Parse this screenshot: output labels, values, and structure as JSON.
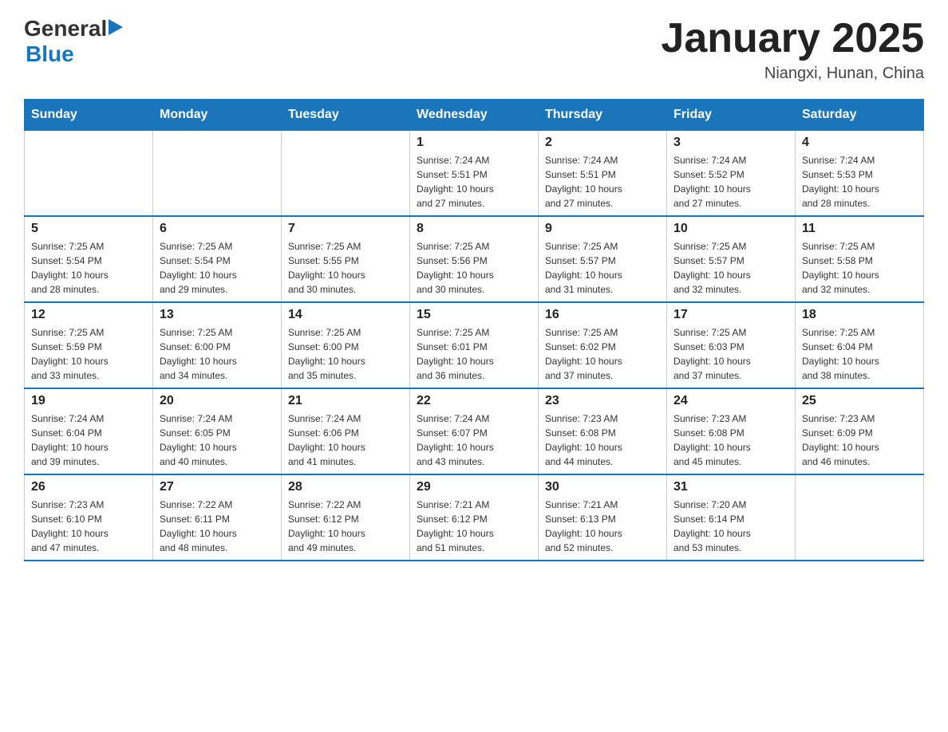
{
  "header": {
    "logo": {
      "general": "General",
      "blue": "Blue",
      "arrow": "▶"
    },
    "title": "January 2025",
    "location": "Niangxi, Hunan, China"
  },
  "calendar": {
    "days_of_week": [
      "Sunday",
      "Monday",
      "Tuesday",
      "Wednesday",
      "Thursday",
      "Friday",
      "Saturday"
    ],
    "weeks": [
      {
        "cells": [
          {
            "day": "",
            "info": ""
          },
          {
            "day": "",
            "info": ""
          },
          {
            "day": "",
            "info": ""
          },
          {
            "day": "1",
            "info": "Sunrise: 7:24 AM\nSunset: 5:51 PM\nDaylight: 10 hours\nand 27 minutes."
          },
          {
            "day": "2",
            "info": "Sunrise: 7:24 AM\nSunset: 5:51 PM\nDaylight: 10 hours\nand 27 minutes."
          },
          {
            "day": "3",
            "info": "Sunrise: 7:24 AM\nSunset: 5:52 PM\nDaylight: 10 hours\nand 27 minutes."
          },
          {
            "day": "4",
            "info": "Sunrise: 7:24 AM\nSunset: 5:53 PM\nDaylight: 10 hours\nand 28 minutes."
          }
        ]
      },
      {
        "cells": [
          {
            "day": "5",
            "info": "Sunrise: 7:25 AM\nSunset: 5:54 PM\nDaylight: 10 hours\nand 28 minutes."
          },
          {
            "day": "6",
            "info": "Sunrise: 7:25 AM\nSunset: 5:54 PM\nDaylight: 10 hours\nand 29 minutes."
          },
          {
            "day": "7",
            "info": "Sunrise: 7:25 AM\nSunset: 5:55 PM\nDaylight: 10 hours\nand 30 minutes."
          },
          {
            "day": "8",
            "info": "Sunrise: 7:25 AM\nSunset: 5:56 PM\nDaylight: 10 hours\nand 30 minutes."
          },
          {
            "day": "9",
            "info": "Sunrise: 7:25 AM\nSunset: 5:57 PM\nDaylight: 10 hours\nand 31 minutes."
          },
          {
            "day": "10",
            "info": "Sunrise: 7:25 AM\nSunset: 5:57 PM\nDaylight: 10 hours\nand 32 minutes."
          },
          {
            "day": "11",
            "info": "Sunrise: 7:25 AM\nSunset: 5:58 PM\nDaylight: 10 hours\nand 32 minutes."
          }
        ]
      },
      {
        "cells": [
          {
            "day": "12",
            "info": "Sunrise: 7:25 AM\nSunset: 5:59 PM\nDaylight: 10 hours\nand 33 minutes."
          },
          {
            "day": "13",
            "info": "Sunrise: 7:25 AM\nSunset: 6:00 PM\nDaylight: 10 hours\nand 34 minutes."
          },
          {
            "day": "14",
            "info": "Sunrise: 7:25 AM\nSunset: 6:00 PM\nDaylight: 10 hours\nand 35 minutes."
          },
          {
            "day": "15",
            "info": "Sunrise: 7:25 AM\nSunset: 6:01 PM\nDaylight: 10 hours\nand 36 minutes."
          },
          {
            "day": "16",
            "info": "Sunrise: 7:25 AM\nSunset: 6:02 PM\nDaylight: 10 hours\nand 37 minutes."
          },
          {
            "day": "17",
            "info": "Sunrise: 7:25 AM\nSunset: 6:03 PM\nDaylight: 10 hours\nand 37 minutes."
          },
          {
            "day": "18",
            "info": "Sunrise: 7:25 AM\nSunset: 6:04 PM\nDaylight: 10 hours\nand 38 minutes."
          }
        ]
      },
      {
        "cells": [
          {
            "day": "19",
            "info": "Sunrise: 7:24 AM\nSunset: 6:04 PM\nDaylight: 10 hours\nand 39 minutes."
          },
          {
            "day": "20",
            "info": "Sunrise: 7:24 AM\nSunset: 6:05 PM\nDaylight: 10 hours\nand 40 minutes."
          },
          {
            "day": "21",
            "info": "Sunrise: 7:24 AM\nSunset: 6:06 PM\nDaylight: 10 hours\nand 41 minutes."
          },
          {
            "day": "22",
            "info": "Sunrise: 7:24 AM\nSunset: 6:07 PM\nDaylight: 10 hours\nand 43 minutes."
          },
          {
            "day": "23",
            "info": "Sunrise: 7:23 AM\nSunset: 6:08 PM\nDaylight: 10 hours\nand 44 minutes."
          },
          {
            "day": "24",
            "info": "Sunrise: 7:23 AM\nSunset: 6:08 PM\nDaylight: 10 hours\nand 45 minutes."
          },
          {
            "day": "25",
            "info": "Sunrise: 7:23 AM\nSunset: 6:09 PM\nDaylight: 10 hours\nand 46 minutes."
          }
        ]
      },
      {
        "cells": [
          {
            "day": "26",
            "info": "Sunrise: 7:23 AM\nSunset: 6:10 PM\nDaylight: 10 hours\nand 47 minutes."
          },
          {
            "day": "27",
            "info": "Sunrise: 7:22 AM\nSunset: 6:11 PM\nDaylight: 10 hours\nand 48 minutes."
          },
          {
            "day": "28",
            "info": "Sunrise: 7:22 AM\nSunset: 6:12 PM\nDaylight: 10 hours\nand 49 minutes."
          },
          {
            "day": "29",
            "info": "Sunrise: 7:21 AM\nSunset: 6:12 PM\nDaylight: 10 hours\nand 51 minutes."
          },
          {
            "day": "30",
            "info": "Sunrise: 7:21 AM\nSunset: 6:13 PM\nDaylight: 10 hours\nand 52 minutes."
          },
          {
            "day": "31",
            "info": "Sunrise: 7:20 AM\nSunset: 6:14 PM\nDaylight: 10 hours\nand 53 minutes."
          },
          {
            "day": "",
            "info": ""
          }
        ]
      }
    ]
  }
}
